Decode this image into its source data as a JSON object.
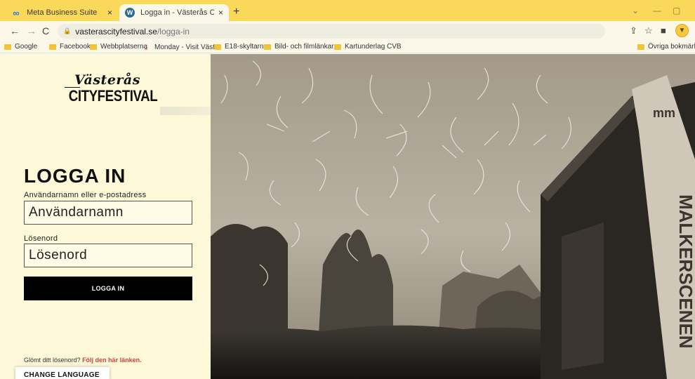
{
  "browser": {
    "tabs": [
      {
        "title": "Meta Business Suite",
        "close": "×",
        "favicon": "meta-icon"
      },
      {
        "title": "Logga in - Västerås Cityfestival",
        "close": "×",
        "favicon": "wordpress-icon"
      }
    ],
    "new_tab": "+",
    "url_host": "vasterascityfestival.se",
    "url_path": "/logga-in",
    "bookmarks": [
      {
        "label": "Google",
        "icon": "folder-icon"
      },
      {
        "label": "Facebook",
        "icon": "folder-icon"
      },
      {
        "label": "Webbplatserna",
        "icon": "folder-icon"
      },
      {
        "label": "Monday - Visit Väst...",
        "icon": "monday-icon"
      },
      {
        "label": "E18-skyltarna",
        "icon": "folder-icon"
      },
      {
        "label": "Bild- och filmlänkar...",
        "icon": "folder-icon"
      },
      {
        "label": "Kartunderlag CVB",
        "icon": "folder-icon"
      },
      {
        "label": "Övriga bokmärken",
        "icon": "folder-icon"
      }
    ]
  },
  "logo": {
    "script": "Västerås",
    "main": "CITYFESTIVAL"
  },
  "login": {
    "title": "LOGGA IN",
    "username_label": "Användarnamn eller e-postadress",
    "username_placeholder": "Användarnamn",
    "password_label": "Lösenord",
    "password_placeholder": "Lösenord",
    "submit_label": "LOGGA IN"
  },
  "forgot": {
    "text": "Glömt ditt lösenord?",
    "link": "Följ den här länken."
  },
  "language": {
    "label": "CHANGE LANGUAGE"
  },
  "hero": {
    "banner_text": "MALKERSCENEN",
    "stage_logo": "mm"
  },
  "colors": {
    "tabbar": "#f9d85a",
    "panel": "#fdf8d8",
    "link": "#c8463f",
    "button": "#000000"
  }
}
